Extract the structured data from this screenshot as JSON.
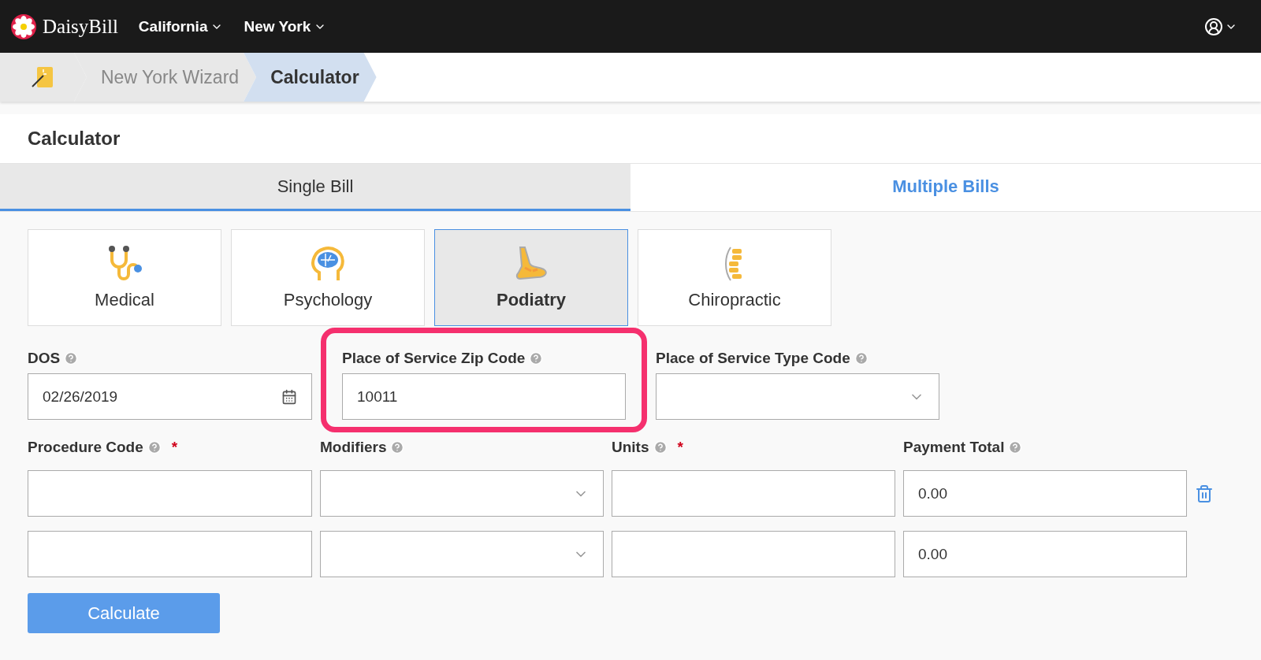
{
  "topbar": {
    "brand": "DaisyBill",
    "menus": [
      {
        "label": "California"
      },
      {
        "label": "New York"
      }
    ]
  },
  "breadcrumb": [
    {
      "label": "New York Wizard",
      "selected": false
    },
    {
      "label": "Calculator",
      "selected": true
    }
  ],
  "page_title": "Calculator",
  "tabs": [
    {
      "label": "Single Bill",
      "selected": true
    },
    {
      "label": "Multiple Bills",
      "selected": false
    }
  ],
  "categories": [
    {
      "kind": "stethoscope",
      "label": "Medical",
      "selected": false
    },
    {
      "kind": "brain",
      "label": "Psychology",
      "selected": false
    },
    {
      "kind": "foot",
      "label": "Podiatry",
      "selected": true
    },
    {
      "kind": "spine",
      "label": "Chiropractic",
      "selected": false
    }
  ],
  "fields": [
    {
      "kind": "date",
      "label": "DOS",
      "value": "02/26/2019",
      "highlighted": false
    },
    {
      "kind": "text",
      "label": "Place of Service Zip Code",
      "value": "10011",
      "highlighted": true
    },
    {
      "kind": "select",
      "label": "Place of Service Type Code",
      "highlighted": false
    }
  ],
  "line_columns": [
    {
      "label": "Procedure Code",
      "required_mark": "*"
    },
    {
      "label": "Modifiers"
    },
    {
      "label": "Units",
      "required_mark": "*"
    },
    {
      "label": "Payment Total"
    }
  ],
  "lines": [
    {
      "payment_total": "0.00",
      "deletable": true
    },
    {
      "payment_total": "0.00",
      "deletable": false
    }
  ],
  "calculate_button": "Calculate"
}
